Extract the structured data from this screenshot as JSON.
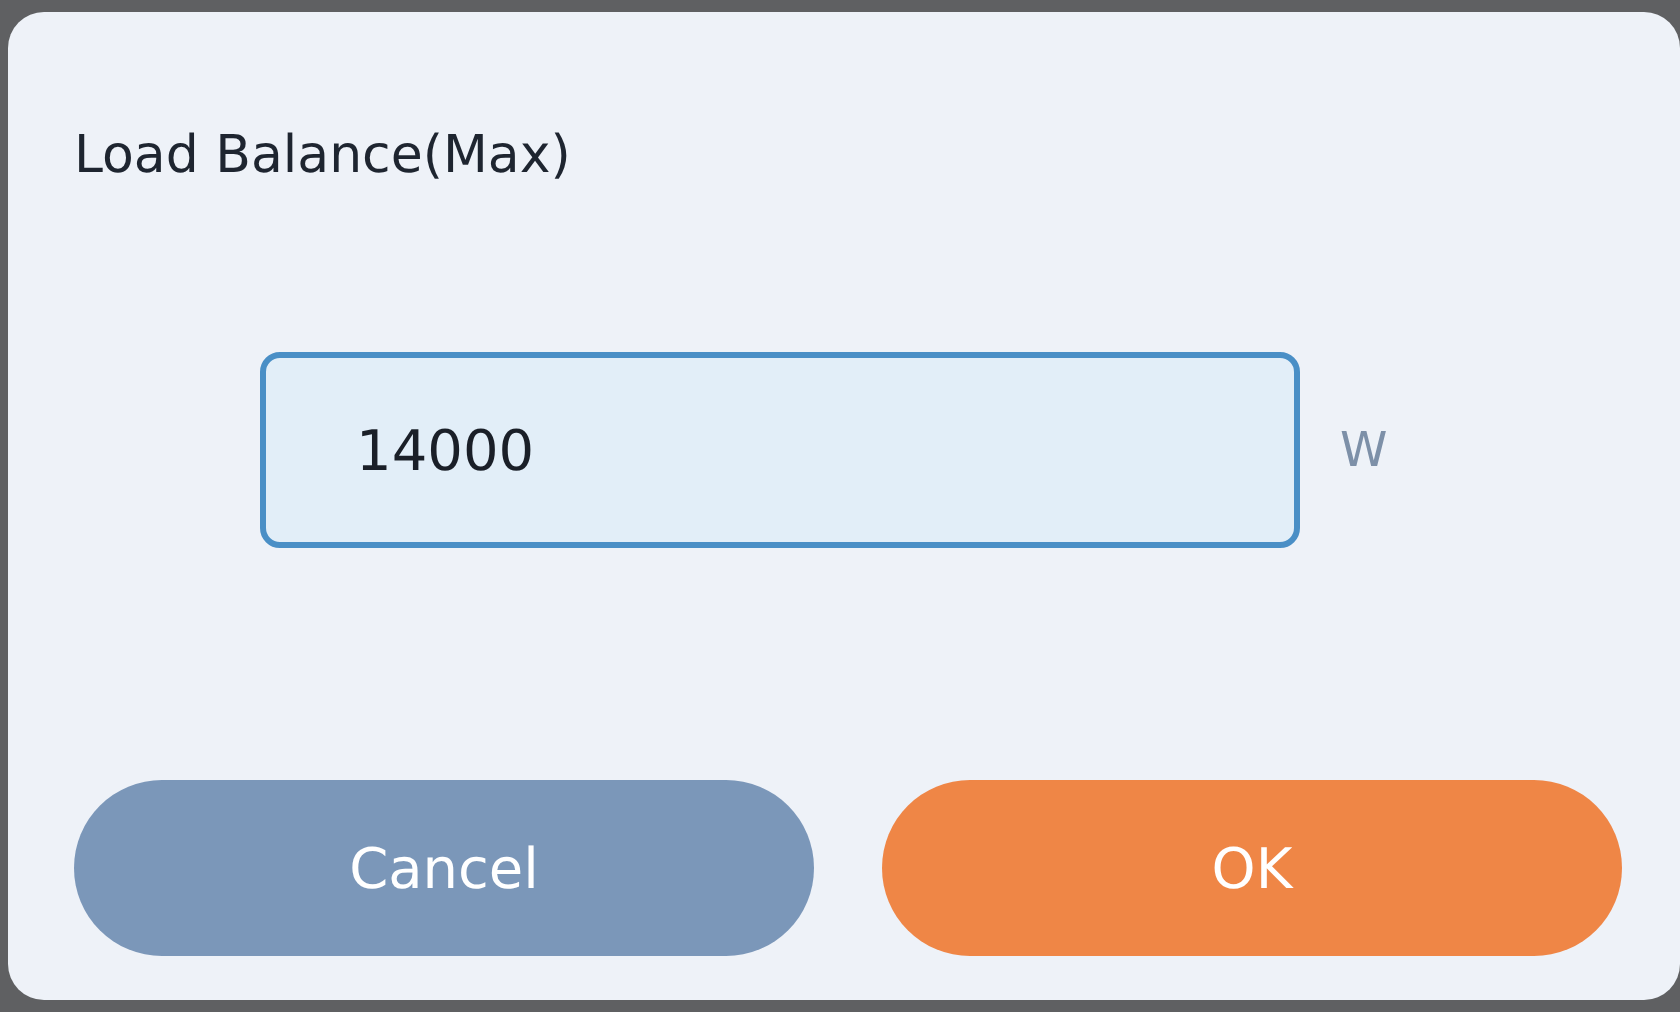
{
  "dialog": {
    "title": "Load Balance(Max)"
  },
  "field": {
    "value": "14000",
    "unit": "W"
  },
  "buttons": [
    {
      "label": "Cancel",
      "kind": "secondary"
    },
    {
      "label": "OK",
      "kind": "primary"
    }
  ]
}
